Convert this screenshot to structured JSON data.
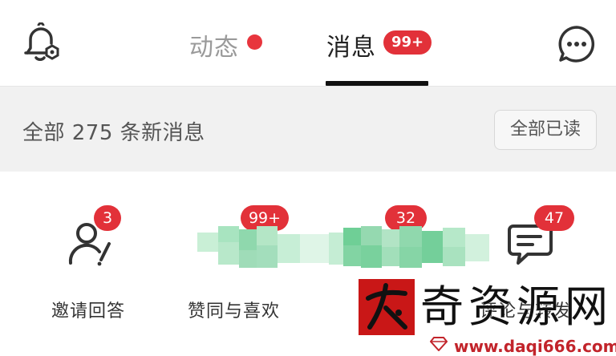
{
  "header": {
    "tab_dynamic": "动态",
    "tab_messages": "消息",
    "messages_badge": "99+"
  },
  "summary": {
    "text": "全部 275 条新消息",
    "read_all": "全部已读"
  },
  "categories": [
    {
      "label": "邀请回答",
      "badge": "3"
    },
    {
      "label": "赞同与喜欢",
      "badge": "99+"
    },
    {
      "label": "",
      "badge": "32"
    },
    {
      "label": "评论与转发",
      "badge": "47"
    }
  ],
  "watermark": {
    "title": "奇资源网",
    "url": "www.daqi666.com"
  },
  "colors": {
    "badge_red": "#e23139",
    "summary_bg": "#f1f1f1"
  }
}
